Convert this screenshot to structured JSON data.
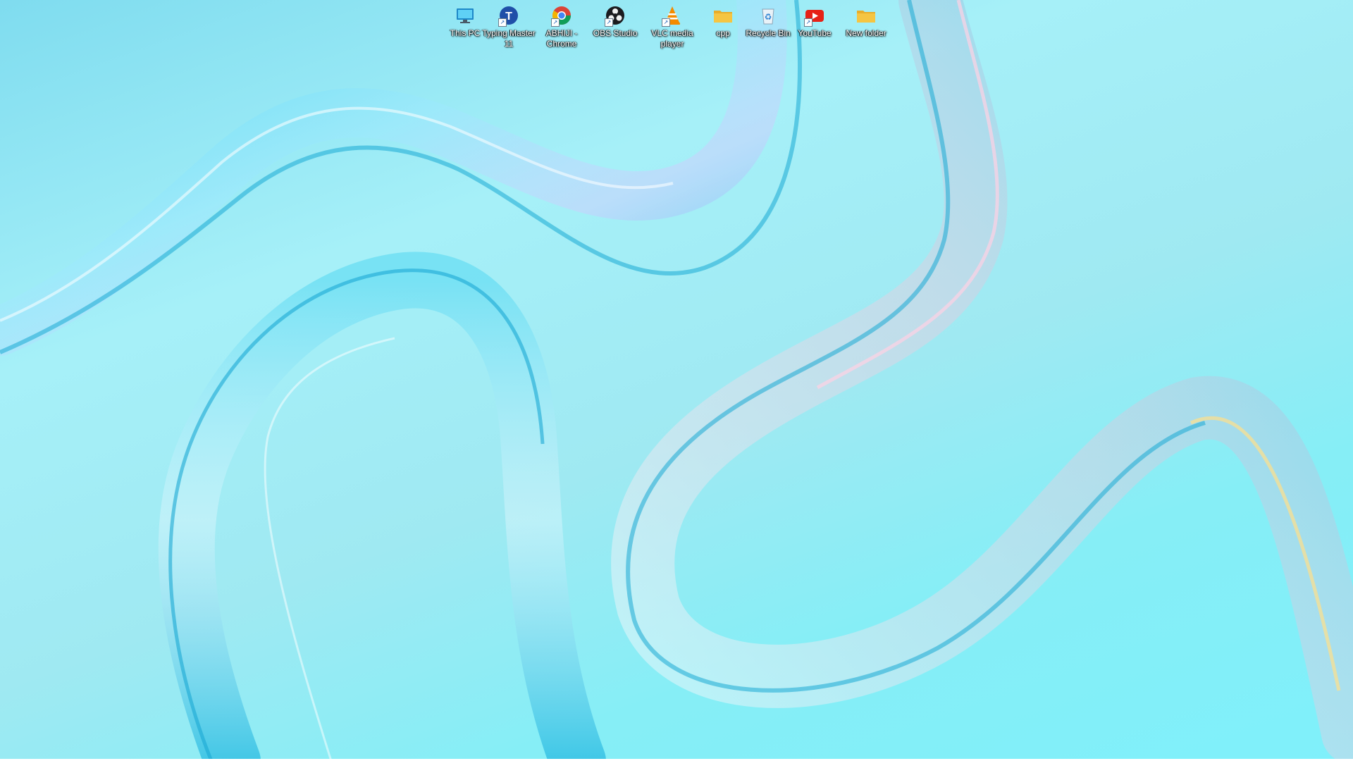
{
  "desktop": {
    "icons": [
      {
        "label": "This PC",
        "icon": "computer-icon",
        "shortcut": false
      },
      {
        "label": "Typing Master 11",
        "icon": "typing-master-icon",
        "shortcut": true
      },
      {
        "label": "ABHIJI - Chrome",
        "icon": "chrome-icon",
        "shortcut": true
      },
      {
        "label": "OBS Studio",
        "icon": "obs-icon",
        "shortcut": true
      },
      {
        "label": "VLC media player",
        "icon": "vlc-icon",
        "shortcut": true
      },
      {
        "label": "cpp",
        "icon": "folder-icon",
        "shortcut": false
      },
      {
        "label": "Recycle Bin",
        "icon": "recycle-bin-icon",
        "shortcut": false
      },
      {
        "label": "YouTube",
        "icon": "youtube-icon",
        "shortcut": true
      },
      {
        "label": "New folder",
        "icon": "folder-icon",
        "shortcut": false
      }
    ]
  },
  "colors": {
    "wallpaper_base": "#a6f0f8",
    "ribbon": "#2ec8e8",
    "folder": "#f5c542",
    "youtube": "#e62117",
    "label_text": "#ffffff"
  }
}
